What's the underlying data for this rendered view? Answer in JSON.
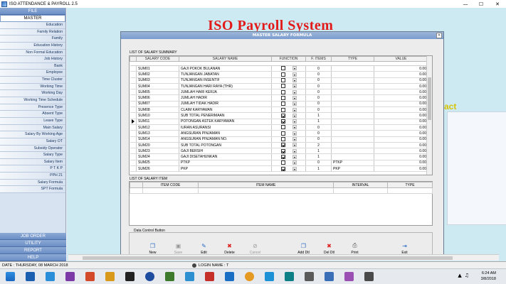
{
  "window": {
    "title": "ISO ATTENDANCE & PAYROLL 2.5"
  },
  "sidebar": {
    "file_label": "FILE",
    "master_label": "MASTER",
    "items": [
      "Education",
      "Family Relation",
      "Family",
      "Education History",
      "Non Formal Education",
      "Job History",
      "Bank",
      "Employee",
      "Time Cluster",
      "Working Time",
      "Working Day",
      "Working Time Schedule",
      "Presence Type",
      "Absent Type",
      "Leave Type",
      "Main Salary",
      "Salary By Working Age",
      "Salary OT",
      "Subsidy Operator",
      "Salary Type",
      "Salary Item",
      "P T K P",
      "PPH 21",
      "Salary Formula",
      "SPT Formula"
    ],
    "bottom": [
      "JOB ORDER",
      "UTILITY",
      "REPORT",
      "HELP"
    ]
  },
  "main": {
    "big_title": "ISO Payroll System",
    "bg_text": "act"
  },
  "dialog": {
    "title": "MASTER SALARY FORMULA",
    "summary_label": "LIST OF SALARY SUMMARY",
    "summary_headers": [
      "SALARY CODE",
      "SALARY NAME",
      "FUNCTION",
      "F. ITEMS",
      "TYPE",
      "VALUE"
    ],
    "rows": [
      {
        "code": "SUM01",
        "name": "GAJI POKOK BULANAN",
        "checked": false,
        "items": "0",
        "type": "",
        "value": "0.00"
      },
      {
        "code": "SUM02",
        "name": "TUNJANGAN JABATAN",
        "checked": false,
        "items": "0",
        "type": "",
        "value": "0.00"
      },
      {
        "code": "SUM03",
        "name": "TUNJANGAN INSENTIF",
        "checked": false,
        "items": "0",
        "type": "",
        "value": "0.00"
      },
      {
        "code": "SUM04",
        "name": "TUNJANGAN HARI RAYA (THR)",
        "checked": false,
        "items": "0",
        "type": "",
        "value": "0.00"
      },
      {
        "code": "SUM05",
        "name": "JUMLAH HARI KERJA",
        "checked": false,
        "items": "0",
        "type": "",
        "value": "0.00"
      },
      {
        "code": "SUM06",
        "name": "JUMLAH HADIR",
        "checked": false,
        "items": "0",
        "type": "",
        "value": "0.00"
      },
      {
        "code": "SUM07",
        "name": "JUMLAH TIDAK HADIR",
        "checked": false,
        "items": "0",
        "type": "",
        "value": "0.00"
      },
      {
        "code": "SUM08",
        "name": "CLAIM KARYAWAN",
        "checked": false,
        "items": "0",
        "type": "",
        "value": "0.00"
      },
      {
        "code": "SUM10",
        "name": "SUB TOTAL PENERIMAAN",
        "checked": true,
        "items": "1",
        "type": "",
        "value": "0.00"
      },
      {
        "code": "SUM11",
        "name": "POTONGAN ASTEK KARYAWAN",
        "checked": true,
        "items": "1",
        "type": "",
        "value": "0.00",
        "current": true
      },
      {
        "code": "SUM12",
        "name": "IURAN ASURANSI",
        "checked": false,
        "items": "0",
        "type": "",
        "value": "0.00"
      },
      {
        "code": "SUM13",
        "name": "ANGSURAN PINJAMAN",
        "checked": false,
        "items": "0",
        "type": "",
        "value": "0.00"
      },
      {
        "code": "SUM14",
        "name": "ANGSURAN PINJAMAN NO.",
        "checked": false,
        "items": "0",
        "type": "",
        "value": "0.00"
      },
      {
        "code": "SUM20",
        "name": "SUB TOTAL POTONGAN",
        "checked": true,
        "items": "2",
        "type": "",
        "value": "0.00"
      },
      {
        "code": "SUM23",
        "name": "GAJI BERSIH",
        "checked": true,
        "items": "1",
        "type": "",
        "value": "0.00"
      },
      {
        "code": "SUM24",
        "name": "GAJI DISETAHUNKAN",
        "checked": true,
        "items": "1",
        "type": "",
        "value": "0.00"
      },
      {
        "code": "SUM25",
        "name": "PTKP",
        "checked": false,
        "items": "0",
        "type": "PTKP",
        "value": "0.00"
      },
      {
        "code": "SUM26",
        "name": "PKP",
        "checked": true,
        "items": "1",
        "type": "PKP",
        "value": "0.00"
      }
    ],
    "item_label": "LIST OF SALARY ITEM",
    "item_headers": [
      "ITEM CODE",
      "ITEM NAME",
      "INTERVAL",
      "TYPE"
    ],
    "buttons_label": "Data Control Button",
    "buttons": [
      {
        "label": "New",
        "icon": "new-icon",
        "enabled": true
      },
      {
        "label": "Save",
        "icon": "save-icon",
        "enabled": false
      },
      {
        "label": "Edit",
        "icon": "edit-icon",
        "enabled": true
      },
      {
        "label": "Delete",
        "icon": "delete-icon",
        "enabled": true
      },
      {
        "label": "Cancel",
        "icon": "cancel-icon",
        "enabled": false
      },
      {
        "label": "Add Dtl",
        "icon": "add-detail-icon",
        "enabled": true
      },
      {
        "label": "Del Dtl",
        "icon": "delete-detail-icon",
        "enabled": true
      },
      {
        "label": "Print",
        "icon": "print-icon",
        "enabled": true
      },
      {
        "label": "Exit",
        "icon": "exit-icon",
        "enabled": true
      }
    ]
  },
  "status": {
    "date": "DATE : THURSDAY, 08 MARCH 2018",
    "login": "LOGIN NAME : T"
  },
  "taskbar": {
    "time": "6:24 AM",
    "date": "3/8/2018"
  }
}
